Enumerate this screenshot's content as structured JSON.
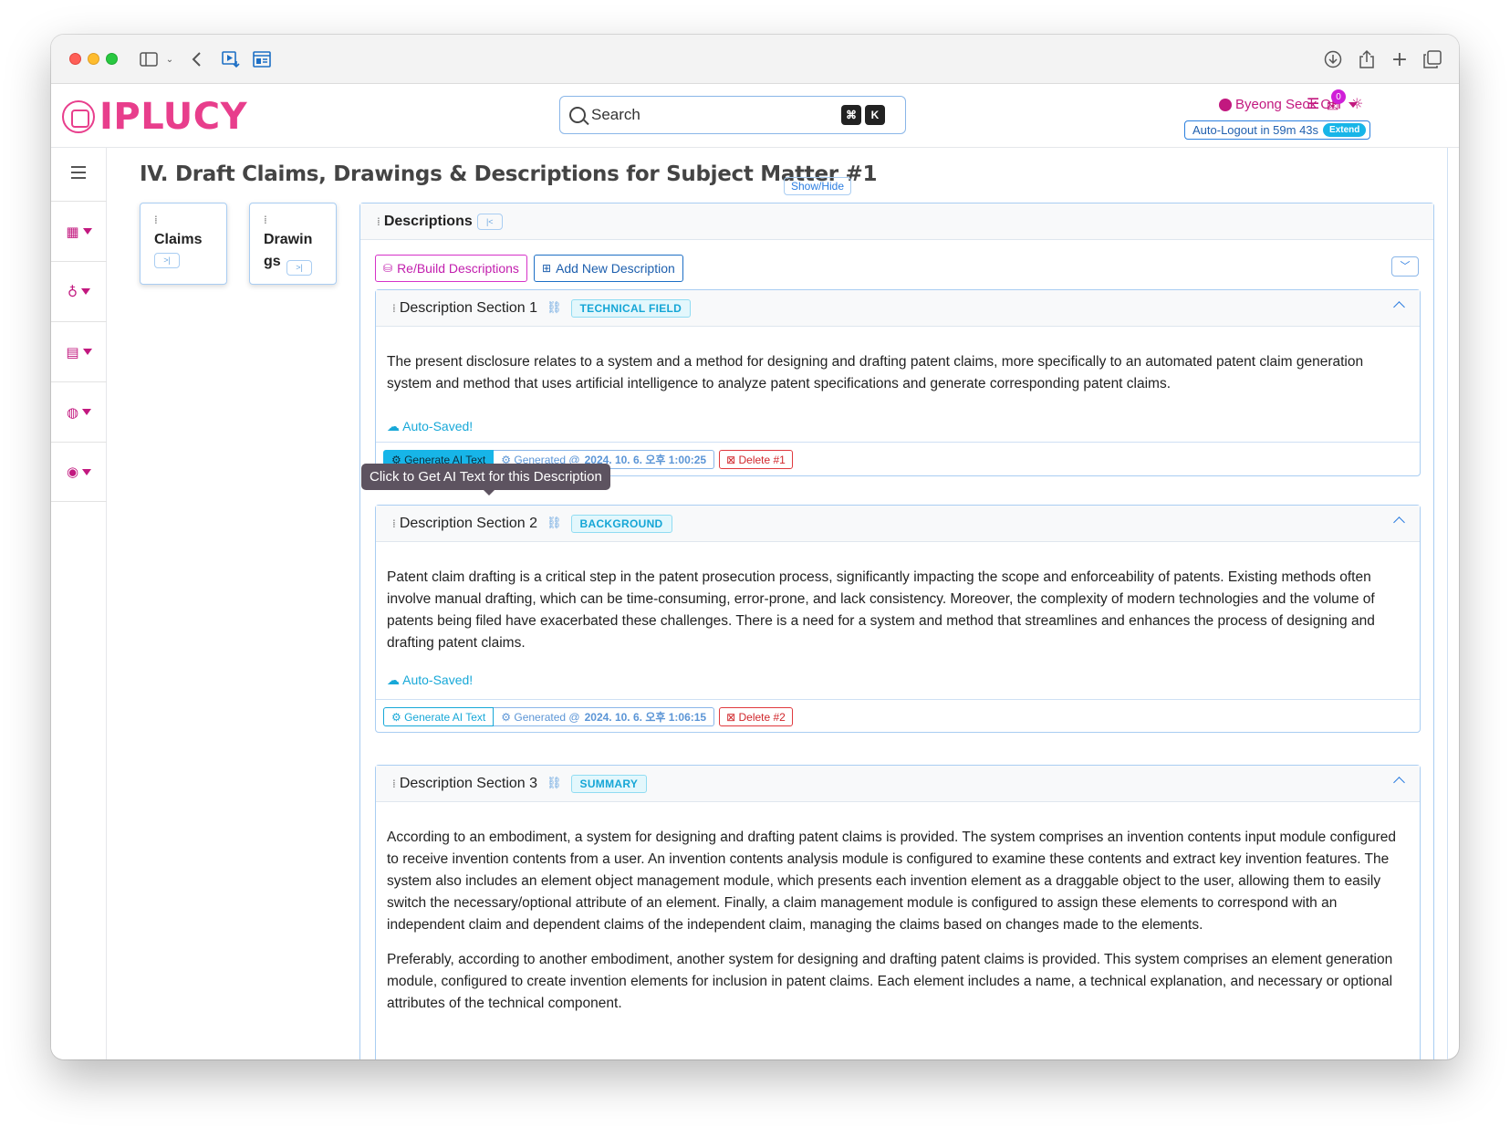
{
  "app": {
    "logo_text": "IPLUCY",
    "search_placeholder": "Search",
    "search_key1": "⌘",
    "search_key2": "K",
    "user_name": "Byeong Seok OH",
    "notification_count": "0",
    "autologout_text": "Auto-Logout in 59m 43s",
    "extend_label": "Extend"
  },
  "page": {
    "title": "IV. Draft Claims, Drawings & Descriptions for Subject Matter #1",
    "showhide_label": "Show/Hide"
  },
  "mini_cards": [
    {
      "title": "Claims",
      "btn": ">|"
    },
    {
      "title": "Drawin gs",
      "btn": ">|"
    }
  ],
  "descriptions": {
    "title": "Descriptions",
    "collapse_label": "|<",
    "rebuild_label": "Re/Build Descriptions",
    "addnew_label": "Add New Description"
  },
  "tooltip": "Click to Get AI Text for this Description",
  "sections": [
    {
      "title": "Description Section 1",
      "tag": "TECHNICAL FIELD",
      "paragraphs": [
        "The present disclosure relates to a system and a method for designing and drafting patent claims, more specifically to an automated patent claim generation system and method that uses artificial intelligence to analyze patent specifications and generate corresponding patent claims."
      ],
      "autosaved": "Auto-Saved!",
      "generate_label": "Generate AI Text",
      "generated_prefix": "Generated @",
      "generated_time": "2024. 10. 6. 오후 1:00:25",
      "delete_label": "Delete #1"
    },
    {
      "title": "Description Section 2",
      "tag": "BACKGROUND",
      "paragraphs": [
        "Patent claim drafting is a critical step in the patent prosecution process, significantly impacting the scope and enforceability of patents. Existing methods often involve manual drafting, which can be time-consuming, error-prone, and lack consistency. Moreover, the complexity of modern technologies and the volume of patents being filed have exacerbated these challenges. There is a need for a system and method that streamlines and enhances the process of designing and drafting patent claims."
      ],
      "autosaved": "Auto-Saved!",
      "generate_label": "Generate AI Text",
      "generated_prefix": "Generated @",
      "generated_time": "2024. 10. 6. 오후 1:06:15",
      "delete_label": "Delete #2"
    },
    {
      "title": "Description Section 3",
      "tag": "SUMMARY",
      "paragraphs": [
        "According to an embodiment, a system for designing and drafting patent claims is provided. The system comprises an invention contents input module configured to receive invention contents from a user. An invention contents analysis module is configured to examine these contents and extract key invention features. The system also includes an element object management module, which presents each invention element as a draggable object to the user, allowing them to easily switch the necessary/optional attribute of an element. Finally, a claim management module is configured to assign these elements to correspond with an independent claim and dependent claims of the independent claim, managing the claims based on changes made to the elements.",
        "Preferably, according to another embodiment, another system for designing and drafting patent claims is provided. This system comprises an element generation module, configured to create invention elements for inclusion in patent claims. Each element includes a name, a technical explanation, and necessary or optional attributes of the technical component."
      ]
    }
  ]
}
